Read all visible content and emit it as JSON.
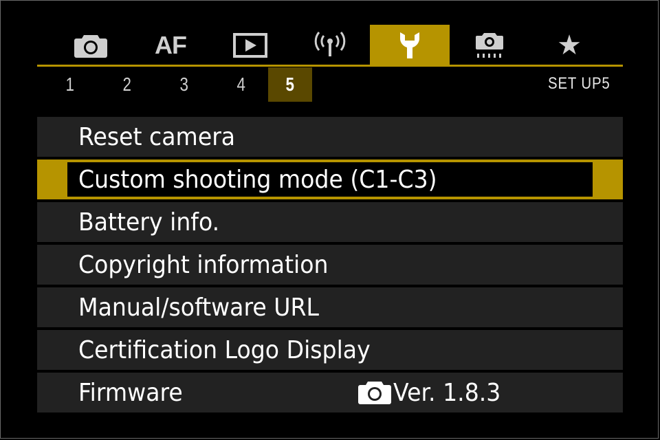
{
  "tabs": [
    {
      "name": "shooting",
      "icon": "camera-icon",
      "label": ""
    },
    {
      "name": "af",
      "icon": "",
      "label": "AF"
    },
    {
      "name": "playback",
      "icon": "play-icon",
      "label": ""
    },
    {
      "name": "wireless",
      "icon": "wireless-icon",
      "label": ""
    },
    {
      "name": "setup",
      "icon": "wrench-icon",
      "label": "",
      "active": true
    },
    {
      "name": "custom-functions",
      "icon": "camera-custom-icon",
      "label": ""
    },
    {
      "name": "my-menu",
      "icon": "star-icon",
      "label": "★"
    }
  ],
  "pages": [
    "1",
    "2",
    "3",
    "4",
    "5"
  ],
  "active_page": "5",
  "page_label": "SET  UP5",
  "menu": {
    "items": [
      {
        "label": "Reset camera"
      },
      {
        "label": "Custom shooting mode (C1-C3)",
        "selected": true
      },
      {
        "label": "Battery info."
      },
      {
        "label": "Copyright information"
      },
      {
        "label": "Manual/software URL"
      },
      {
        "label": "Certification Logo Display"
      },
      {
        "label": "Firmware",
        "value": "Ver. 1.8.3",
        "value_icon": "camera-icon"
      }
    ]
  },
  "colors": {
    "accent": "#b69400",
    "active_page_bg": "#5a4800",
    "item_bg": "#222222",
    "background": "#000000"
  }
}
